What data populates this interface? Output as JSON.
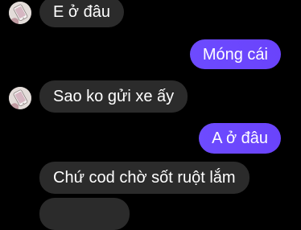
{
  "colors": {
    "background": "#000000",
    "incoming_bubble": "#2b2b2b",
    "outgoing_bubble": "#6a45ff",
    "text": "#ffffff"
  },
  "avatar": {
    "icon": "contact-avatar-photo"
  },
  "messages": [
    {
      "sender": "contact",
      "text": "E ở đâu"
    },
    {
      "sender": "me",
      "text": "Móng cái"
    },
    {
      "sender": "contact",
      "text": "Sao ko gửi xe ấy"
    },
    {
      "sender": "me",
      "text": "A ở đâu"
    },
    {
      "sender": "contact",
      "text": "Chứ cod chờ sốt ruột lắm"
    }
  ]
}
